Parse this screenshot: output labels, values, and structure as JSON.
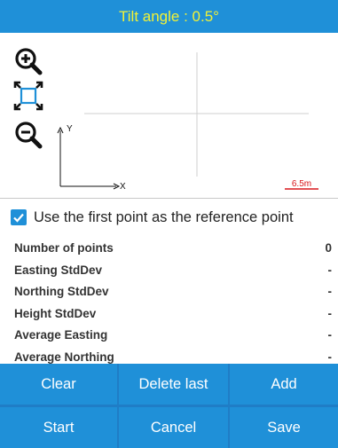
{
  "header": {
    "title": "Tilt angle : 0.5°"
  },
  "plot": {
    "y_axis_label": "Y",
    "x_axis_label": "X",
    "scale_label": "6.5m",
    "tools": [
      "zoom-in-icon",
      "fit-extent-icon",
      "zoom-out-icon"
    ],
    "colors": {
      "scale": "#d8161b",
      "crosshair": "#cfcfcf"
    }
  },
  "reference": {
    "label": "Use the first point as the reference point",
    "checked": true
  },
  "stats": [
    {
      "label": "Number of points",
      "value": "0"
    },
    {
      "label": "Easting StdDev",
      "value": "-"
    },
    {
      "label": "Northing StdDev",
      "value": "-"
    },
    {
      "label": "Height StdDev",
      "value": "-"
    },
    {
      "label": "Average Easting",
      "value": "-"
    },
    {
      "label": "Average Northing",
      "value": "-"
    }
  ],
  "buttons": {
    "clear": "Clear",
    "delete_last": "Delete last",
    "add": "Add",
    "start": "Start",
    "cancel": "Cancel",
    "save": "Save"
  },
  "theme": {
    "primary": "#1f90d8",
    "title_text": "#f2f236"
  }
}
